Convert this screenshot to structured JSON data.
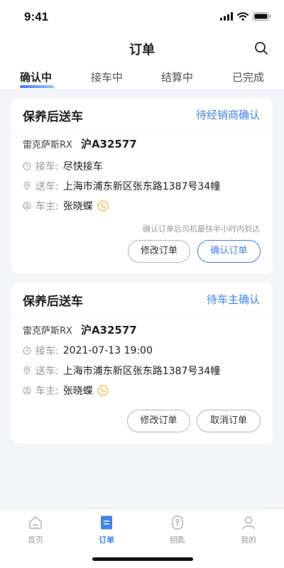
{
  "status_bar": {
    "time": "9:41"
  },
  "nav": {
    "title": "订单",
    "search_icon": "search-icon"
  },
  "tabs": [
    {
      "label": "确认中",
      "active": true
    },
    {
      "label": "接车中",
      "active": false
    },
    {
      "label": "结算中",
      "active": false
    },
    {
      "label": "已完成",
      "active": false
    }
  ],
  "orders": [
    {
      "title": "保养后送车",
      "status": "待经销商确认",
      "model": "雷克萨斯RX",
      "plate": "沪A32577",
      "pickup_label": "接车:",
      "pickup_value": "尽快接车",
      "delivery_label": "送车:",
      "delivery_value": "上海市浦东新区张东路1387号34幢",
      "owner_label": "车主:",
      "owner_value": "张晓蝶",
      "note": "确认订单后司机最快半小时内到达",
      "buttons": [
        "修改订单",
        "确认订单"
      ]
    },
    {
      "title": "保养后送车",
      "status": "待车主确认",
      "model": "雷克萨斯RX",
      "plate": "沪A32577",
      "pickup_label": "接车:",
      "pickup_value": "2021-07-13 19:00",
      "delivery_label": "送车:",
      "delivery_value": "上海市浦东新区张东路1387号34幢",
      "owner_label": "车主:",
      "owner_value": "张晓蝶",
      "buttons": [
        "修改订单",
        "取消订单"
      ]
    }
  ],
  "bottom_nav": [
    {
      "label": "首页",
      "icon": "home-icon",
      "active": false
    },
    {
      "label": "订单",
      "icon": "order-icon",
      "active": true
    },
    {
      "label": "钥匙",
      "icon": "key-icon",
      "active": false
    },
    {
      "label": "我的",
      "icon": "profile-icon",
      "active": false
    }
  ],
  "colors": {
    "accent": "#3e83e8",
    "background": "#f4f5f8",
    "card": "#ffffff",
    "phone_badge": "#e8b84a"
  }
}
